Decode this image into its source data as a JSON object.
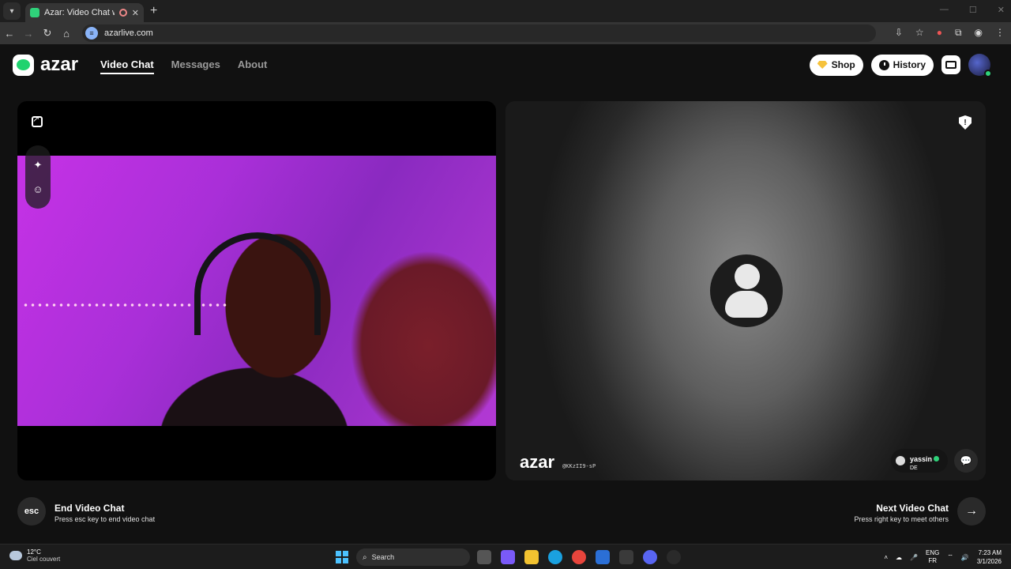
{
  "browser": {
    "tab_title": "Azar: Video Chat with New",
    "tab_close": "✕",
    "new_tab": "+",
    "url": "azarlive.com"
  },
  "site": {
    "logo_text": "azar",
    "nav": [
      {
        "label": "Video Chat",
        "active": true
      },
      {
        "label": "Messages",
        "active": false
      },
      {
        "label": "About",
        "active": false
      }
    ],
    "shop_label": "Shop",
    "history_label": "History"
  },
  "peer": {
    "watermark": "azar",
    "code": "@KKzII9-sP",
    "name": "yassin",
    "country": "DE"
  },
  "controls": {
    "esc_label": "esc",
    "end_title": "End Video Chat",
    "end_sub": "Press esc key to end video chat",
    "next_title": "Next Video Chat",
    "next_sub": "Press right key to meet others"
  },
  "taskbar": {
    "temperature": "12°C",
    "condition": "Ciel couvert",
    "search_placeholder": "Search",
    "lang_top": "ENG",
    "lang_bottom": "FR",
    "time": "7:23 AM",
    "date": "3/1/2026"
  },
  "colors": {
    "accent_green": "#2fd27a",
    "background": "#111111"
  }
}
